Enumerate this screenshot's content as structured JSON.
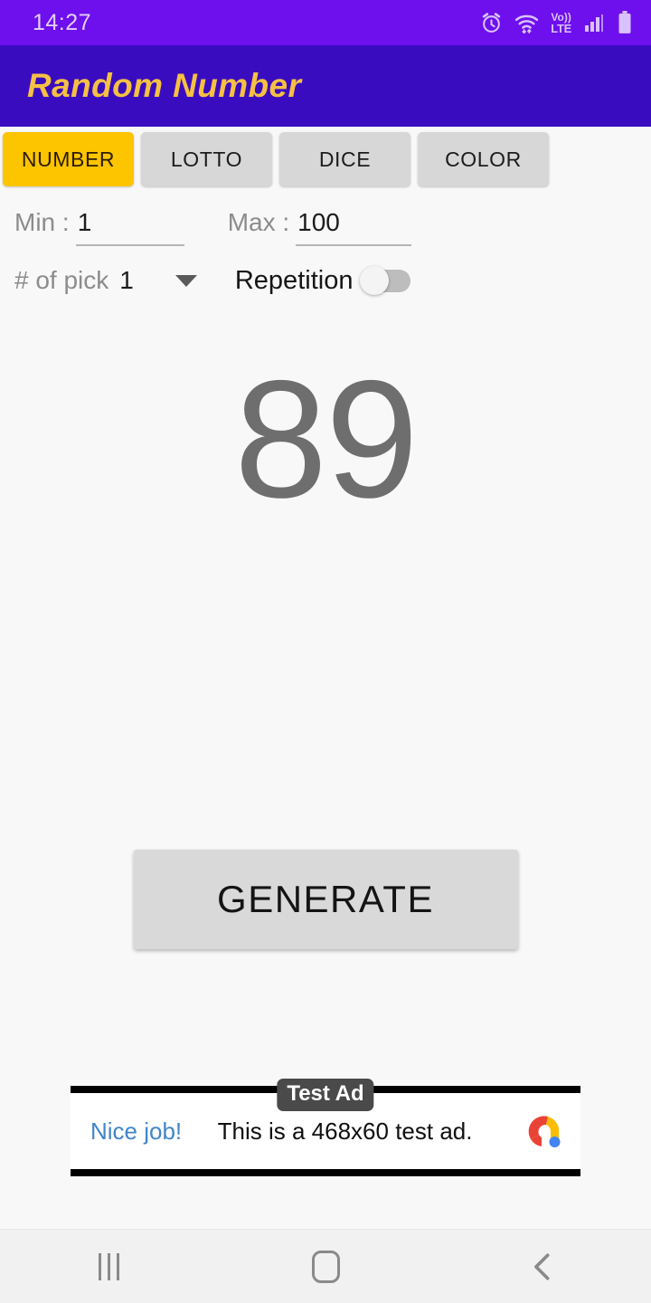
{
  "status_bar": {
    "time": "14:27",
    "icons": [
      {
        "name": "alarm-icon"
      },
      {
        "name": "wifi-icon"
      },
      {
        "name": "volte-icon",
        "top": "Vo))",
        "bottom": "LTE"
      },
      {
        "name": "signal-icon"
      },
      {
        "name": "battery-icon"
      }
    ],
    "bg_color": "#6e0fee",
    "text_color": "#e3cffb"
  },
  "app_bar": {
    "title": "Random Number",
    "bg_color": "#3a0cc0",
    "title_color": "#f5c044"
  },
  "tabs": {
    "selected_index": 0,
    "selected_bg": "#fdc400",
    "unselected_bg": "#d7d7d7",
    "items": [
      {
        "label": "NUMBER"
      },
      {
        "label": "LOTTO"
      },
      {
        "label": "DICE"
      },
      {
        "label": "COLOR"
      }
    ]
  },
  "range": {
    "min_label": "Min :",
    "min_value": "1",
    "max_label": "Max :",
    "max_value": "100"
  },
  "pick": {
    "label": "# of pick",
    "value": "1",
    "dropdown_icon": "chevron-down-icon",
    "repetition_label": "Repetition",
    "repetition_on": false
  },
  "result": {
    "value": "89",
    "color": "#6e6e6e"
  },
  "actions": {
    "generate_label": "GENERATE"
  },
  "ad": {
    "badge": "Test Ad",
    "cta": "Nice job!",
    "text": "This is a 468x60 test ad.",
    "logo_icon": "google-ads-logo-icon",
    "cta_color": "#4285c8"
  },
  "nav_bar": {
    "recents_label": "recents-icon",
    "home_label": "home-icon",
    "back_label": "back-icon"
  }
}
